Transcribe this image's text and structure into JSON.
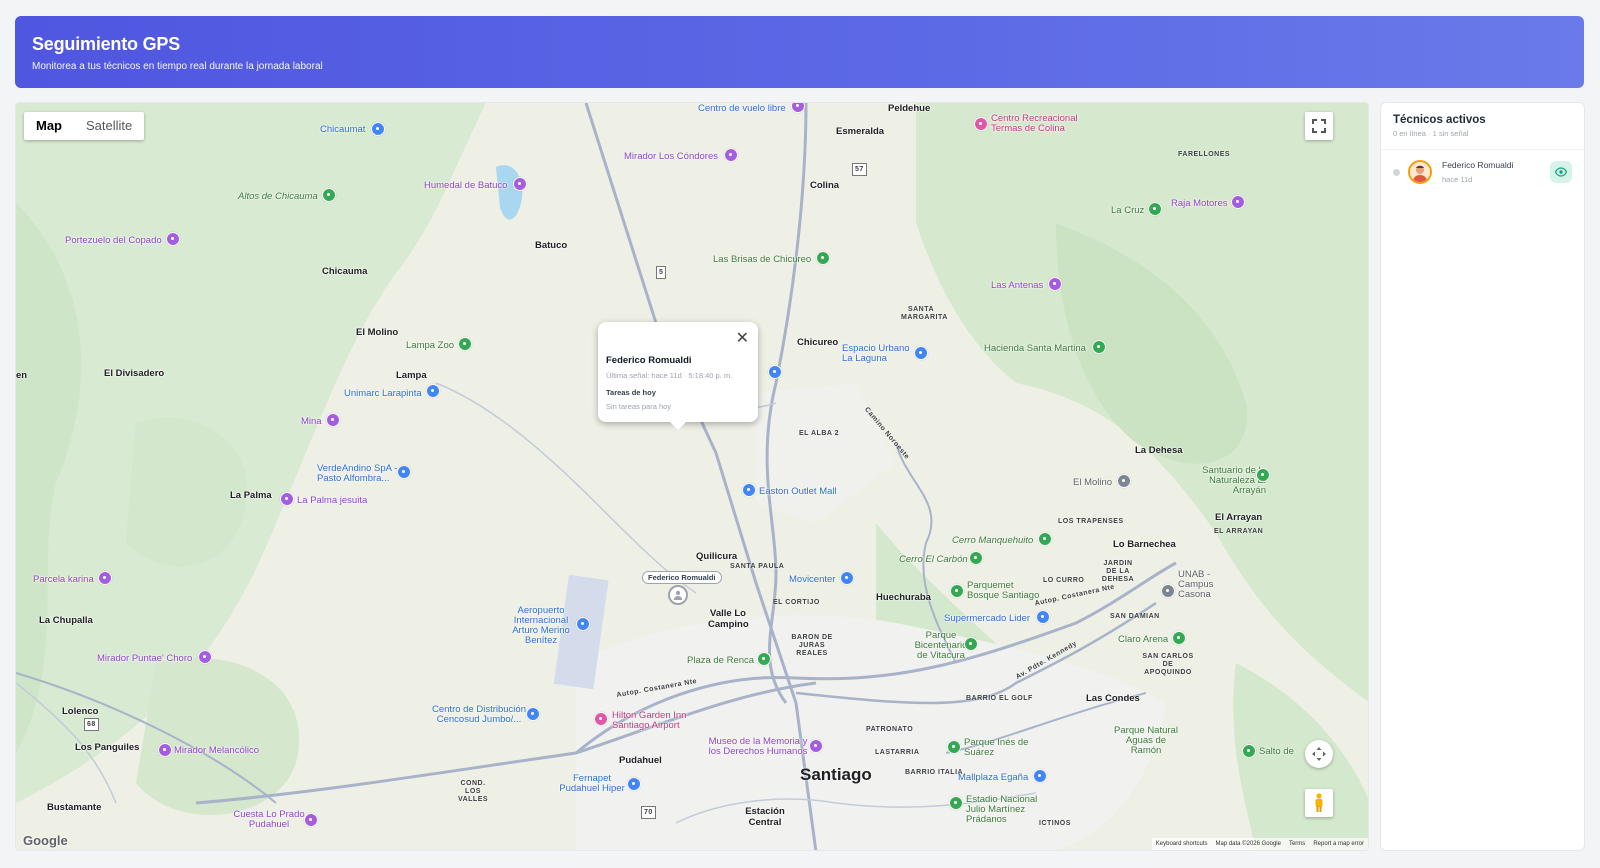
{
  "header": {
    "title": "Seguimiento GPS",
    "subtitle": "Monitorea a tus técnicos en tiempo real durante la jornada laboral"
  },
  "map": {
    "type_controls": [
      "Map",
      "Satellite"
    ],
    "active_type": "Map",
    "provider_logo": "Google",
    "attribution": [
      "Keyboard shortcuts",
      "Map data ©2026 Google",
      "Terms",
      "Report a map error"
    ],
    "labels": {
      "towns": [
        "Peldehue",
        "Esmeralda",
        "Colina",
        "Batuco",
        "Chicauma",
        "El Molino",
        "Lampa",
        "El Divisadero",
        "La Palma",
        "La Chupalla",
        "Lolenco",
        "Los Panguiles",
        "Bustamante",
        "Chicureo",
        "Quilicura",
        "Valle Lo Campino",
        "Huechuraba",
        "Pudahuel",
        "Estación Central",
        "La Dehesa",
        "Lo Barnechea",
        "Las Condes",
        "El Arrayan",
        "en"
      ],
      "city": "Santiago",
      "districts": [
        "FARELLONES",
        "SANTA MARGARITA",
        "EL ALBA 2",
        "LOS TRAPENSES",
        "EL ARRAYAN",
        "JARDIN DE LA DEHESA",
        "LO CURRO",
        "SAN DAMIAN",
        "SANTA PAULA",
        "EL CORTIJO",
        "BARON DE JURAS REALES",
        "SAN CARLOS DE APOQUINDO",
        "BARRIO EL GOLF",
        "PATRONATO",
        "LASTARRIA",
        "BARRIO ITALIA",
        "COND. LOS VALLES",
        "ICTINOS"
      ],
      "pois": [
        "Centro de vuelo libre",
        "Centro Recreacional Termas de Colina",
        "Chicaumat",
        "Mirador Los Cóndores",
        "Humedal de Batuco",
        "Altos de Chicauma",
        "Portezuelo del Copado",
        "Las Brisas de Chicureo",
        "Raja Motores",
        "La Cruz",
        "Las Antenas",
        "Lampa Zoo",
        "Espacio Urbano La Laguna",
        "Hacienda Santa Martina",
        "Unimarc Larapinta",
        "Mina",
        "VerdeAndino SpA - Pasto Alfombra...",
        "La Palma jesuita",
        "Easton Outlet Mall",
        "El Molino",
        "Santuario de la Naturaleza El Arrayán",
        "Cerro Manquehuito",
        "Cerro El Carbón",
        "Parcela karina",
        "Movicenter",
        "Parquemet Bosque Santiago",
        "UNAB - Campus Casona",
        "Supermercado Lider",
        "Aeropuerto Internacional Arturo Merino Benítez",
        "Parque Bicentenario de Vitacura",
        "Claro Arena",
        "Plaza de Renca",
        "Mirador Puntae' Choro",
        "Centro de Distribución Cencosud Jumbo/...",
        "Hilton Garden Inn Santiago Airport",
        "Museo de la Memoria y los Derechos Humanos",
        "Parque Inés de Suárez",
        "Parque Natural Aguas de Ramón",
        "Salto de",
        "Mirador Melancólico",
        "Fernapet Pudahuel Hiper",
        "Mallplaza Egaña",
        "Cuesta Lo Prado Pudahuel",
        "Estadio Nacional Julio Martínez Prádanos"
      ],
      "roads": [
        "Autop. Costanera Nte",
        "Autop. Costanera Nte",
        "Camino Noroeste",
        "Av. Pdte. Kennedy"
      ],
      "shields": [
        "5",
        "57",
        "68",
        "70"
      ]
    },
    "popup": {
      "name": "Federico Romualdi",
      "last_signal": "Última señal: hace 11d · 5:18:40 p. m.",
      "tasks_title": "Tareas de hoy",
      "tasks_empty": "Sin tareas para hoy"
    },
    "marker_label": "Federico Romualdi"
  },
  "sidebar": {
    "title": "Técnicos activos",
    "summary": "0 en línea · 1 sin señal",
    "technicians": [
      {
        "name": "Federico Romualdi",
        "last_seen": "hace 11d",
        "status_color": "#d1d5db"
      }
    ]
  },
  "colors": {
    "brand": "#4f56e0",
    "accent": "#10b981"
  },
  "icons": [
    "fullscreen-icon",
    "close-icon",
    "eye-icon",
    "pegman-icon",
    "camera-control-icon",
    "person-pin-icon"
  ]
}
